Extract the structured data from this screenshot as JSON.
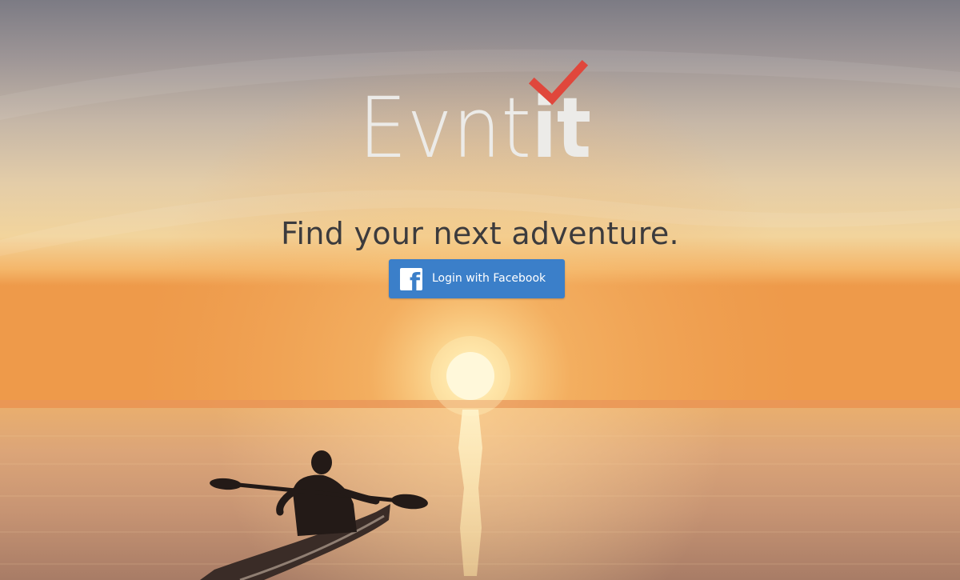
{
  "app": {
    "logo_text_light": "Evnt",
    "logo_text_bold": "it",
    "logo_icon": "checkmark-icon"
  },
  "hero": {
    "tagline": "Find your next adventure.",
    "background": "sunset-kayak-photo"
  },
  "login": {
    "facebook_button_label": "Login with Facebook",
    "facebook_icon_glyph": "f",
    "facebook_icon": "facebook-icon"
  },
  "colors": {
    "facebook_blue": "#3b7fc9",
    "checkmark_red": "#e0473c",
    "logo_light": "#ecebe8",
    "tagline_dark": "#3c3b3d"
  }
}
